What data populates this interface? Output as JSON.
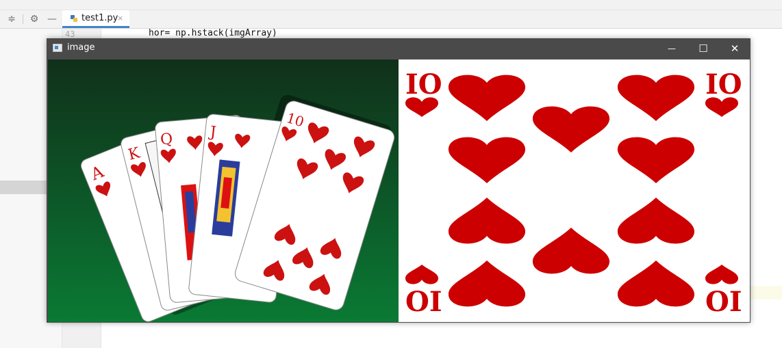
{
  "ide": {
    "tab_label": "test1.py",
    "tab_close": "×",
    "line_number": "43",
    "code_line": "hor= np.hstack(imgArray)"
  },
  "window": {
    "title": "image",
    "minimize": "—",
    "maximize": "☐",
    "close": "✕"
  },
  "left_image": {
    "cards": [
      {
        "rank": "A",
        "suit": "heart"
      },
      {
        "rank": "K",
        "suit": "heart"
      },
      {
        "rank": "Q",
        "suit": "heart"
      },
      {
        "rank": "J",
        "suit": "heart"
      },
      {
        "rank": "10",
        "suit": "heart"
      }
    ],
    "background": "#0b5a2a"
  },
  "right_image": {
    "rank": "10",
    "suit": "heart",
    "color": "#cc0000"
  }
}
